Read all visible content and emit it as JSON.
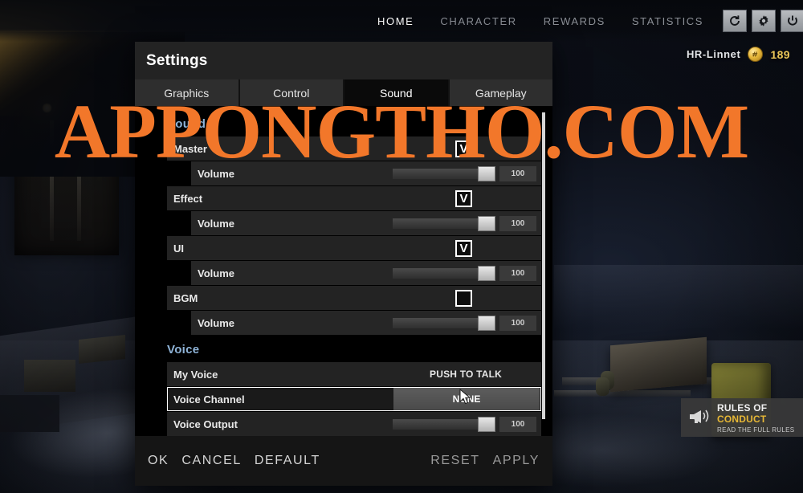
{
  "topnav": {
    "items": [
      {
        "label": "HOME",
        "active": true
      },
      {
        "label": "CHARACTER",
        "active": false
      },
      {
        "label": "REWARDS",
        "active": false
      },
      {
        "label": "STATISTICS",
        "active": false
      }
    ],
    "icons": [
      {
        "name": "refresh-icon"
      },
      {
        "name": "gear-icon"
      },
      {
        "name": "power-icon"
      }
    ]
  },
  "player": {
    "name": "HR-Linnet",
    "currency_icon": "coin-icon",
    "currency_value": "189"
  },
  "dialog": {
    "title": "Settings",
    "tabs": [
      {
        "label": "Graphics",
        "active": false
      },
      {
        "label": "Control",
        "active": false
      },
      {
        "label": "Sound",
        "active": true
      },
      {
        "label": "Gameplay",
        "active": false
      }
    ],
    "sections": [
      {
        "header": "Sound",
        "rows": [
          {
            "label": "Master",
            "type": "checkbox",
            "checked": true
          },
          {
            "label": "Volume",
            "type": "slider",
            "value": "100",
            "fill": 100
          },
          {
            "label": "Effect",
            "type": "checkbox",
            "checked": true
          },
          {
            "label": "Volume",
            "type": "slider",
            "value": "100",
            "fill": 100
          },
          {
            "label": "UI",
            "type": "checkbox",
            "checked": true
          },
          {
            "label": "Volume",
            "type": "slider",
            "value": "100",
            "fill": 100
          },
          {
            "label": "BGM",
            "type": "checkbox",
            "checked": false
          },
          {
            "label": "Volume",
            "type": "slider",
            "value": "100",
            "fill": 100
          }
        ]
      },
      {
        "header": "Voice",
        "rows": [
          {
            "label": "My Voice",
            "type": "text",
            "value": "PUSH TO TALK"
          },
          {
            "label": "Voice Channel",
            "type": "button",
            "value": "NONE",
            "hovered": true
          },
          {
            "label": "Voice Output",
            "type": "slider",
            "value": "100",
            "fill": 100
          }
        ]
      }
    ],
    "footer": {
      "left": [
        "OK",
        "CANCEL",
        "DEFAULT"
      ],
      "right": [
        "RESET",
        "APPLY"
      ]
    },
    "checkmark_glyph": "V"
  },
  "rules_banner": {
    "title_plain": "RULES OF ",
    "title_highlight": "CONDUCT",
    "subtitle": "READ THE FULL RULES",
    "icon": "megaphone-icon"
  },
  "watermark": {
    "text": "APPONGTHO.COM",
    "color": "#f2772a"
  },
  "colors": {
    "accent_orange": "#f2772a",
    "section_blue": "#8fb4d8",
    "gold": "#e8b835",
    "dialog_bg": "#121212",
    "row_bg": "#232323"
  }
}
